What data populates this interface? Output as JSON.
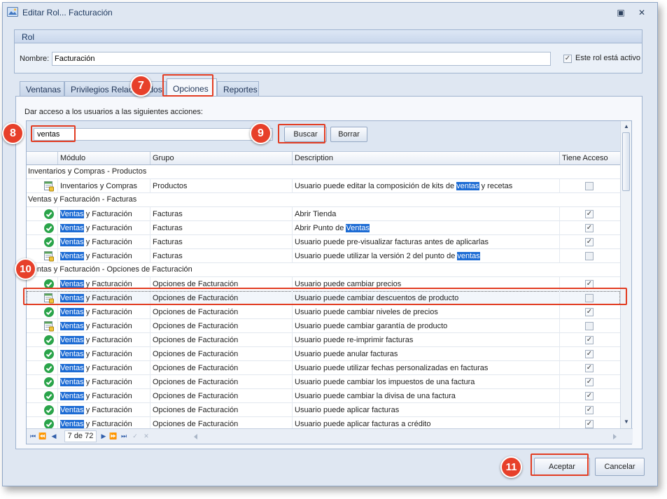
{
  "window": {
    "title": "Editar Rol... Facturación"
  },
  "rol_group": {
    "header": "Rol",
    "nombre_label": "Nombre:",
    "nombre_value": "Facturación",
    "activo_label": "Este rol está activo",
    "activo_checked": true
  },
  "tabs": [
    {
      "label": "Ventanas",
      "active": false
    },
    {
      "label": "Privilegios Relacionados",
      "active": false
    },
    {
      "label": "Opciones",
      "active": true
    },
    {
      "label": "Reportes",
      "active": false
    }
  ],
  "intro_text": "Dar acceso a los usuarios a las siguientes acciones:",
  "search": {
    "value": "ventas",
    "buscar_label": "Buscar",
    "borrar_label": "Borrar"
  },
  "columns": {
    "modulo": "Módulo",
    "grupo": "Grupo",
    "description": "Description",
    "acceso": "Tiene Acceso"
  },
  "groups": [
    "Inventarios y Compras - Productos",
    "Ventas y Facturación - Facturas",
    "Ventas y Facturación - Opciones de Facturación"
  ],
  "rows": [
    {
      "icon": "pending-icon",
      "modulo_hl": "",
      "modulo_rest": "Inventarios y Compras",
      "grupo": "Productos",
      "desc_pre": "Usuario puede editar la composición de kits de ",
      "desc_hl": "ventas",
      "desc_post": " y recetas",
      "acceso": false
    },
    {
      "icon": "granted-icon",
      "modulo_hl": "Ventas",
      "modulo_rest": " y Facturación",
      "grupo": "Facturas",
      "desc_pre": "Abrir Tienda",
      "desc_hl": "",
      "desc_post": "",
      "acceso": true
    },
    {
      "icon": "granted-icon",
      "modulo_hl": "Ventas",
      "modulo_rest": " y Facturación",
      "grupo": "Facturas",
      "desc_pre": "Abrir Punto de ",
      "desc_hl": "Ventas",
      "desc_post": "",
      "acceso": true
    },
    {
      "icon": "granted-icon",
      "modulo_hl": "Ventas",
      "modulo_rest": " y Facturación",
      "grupo": "Facturas",
      "desc_pre": "Usuario puede pre-visualizar facturas antes de aplicarlas",
      "desc_hl": "",
      "desc_post": "",
      "acceso": true
    },
    {
      "icon": "pending-icon",
      "modulo_hl": "Ventas",
      "modulo_rest": " y Facturación",
      "grupo": "Facturas",
      "desc_pre": "Usuario puede utilizar la versión 2 del punto de ",
      "desc_hl": "ventas",
      "desc_post": "",
      "acceso": false
    },
    {
      "icon": "granted-icon",
      "modulo_hl": "Ventas",
      "modulo_rest": " y Facturación",
      "grupo": "Opciones de Facturación",
      "desc_pre": "Usuario puede cambiar precios",
      "desc_hl": "",
      "desc_post": "",
      "acceso": true
    },
    {
      "icon": "pending-icon",
      "modulo_hl": "Ventas",
      "modulo_rest": " y Facturación",
      "grupo": "Opciones de Facturación",
      "desc_pre": "Usuario puede cambiar descuentos de producto",
      "desc_hl": "",
      "desc_post": "",
      "acceso": false
    },
    {
      "icon": "granted-icon",
      "modulo_hl": "Ventas",
      "modulo_rest": " y Facturación",
      "grupo": "Opciones de Facturación",
      "desc_pre": "Usuario puede cambiar niveles de precios",
      "desc_hl": "",
      "desc_post": "",
      "acceso": true
    },
    {
      "icon": "pending-icon",
      "modulo_hl": "Ventas",
      "modulo_rest": " y Facturación",
      "grupo": "Opciones de Facturación",
      "desc_pre": "Usuario puede cambiar garantía de producto",
      "desc_hl": "",
      "desc_post": "",
      "acceso": false
    },
    {
      "icon": "granted-icon",
      "modulo_hl": "Ventas",
      "modulo_rest": " y Facturación",
      "grupo": "Opciones de Facturación",
      "desc_pre": "Usuario puede re-imprimir facturas",
      "desc_hl": "",
      "desc_post": "",
      "acceso": true
    },
    {
      "icon": "granted-icon",
      "modulo_hl": "Ventas",
      "modulo_rest": " y Facturación",
      "grupo": "Opciones de Facturación",
      "desc_pre": "Usuario puede anular facturas",
      "desc_hl": "",
      "desc_post": "",
      "acceso": true
    },
    {
      "icon": "granted-icon",
      "modulo_hl": "Ventas",
      "modulo_rest": " y Facturación",
      "grupo": "Opciones de Facturación",
      "desc_pre": "Usuario puede utilizar fechas personalizadas en facturas",
      "desc_hl": "",
      "desc_post": "",
      "acceso": true
    },
    {
      "icon": "granted-icon",
      "modulo_hl": "Ventas",
      "modulo_rest": " y Facturación",
      "grupo": "Opciones de Facturación",
      "desc_pre": "Usuario puede cambiar los impuestos de una factura",
      "desc_hl": "",
      "desc_post": "",
      "acceso": true
    },
    {
      "icon": "granted-icon",
      "modulo_hl": "Ventas",
      "modulo_rest": " y Facturación",
      "grupo": "Opciones de Facturación",
      "desc_pre": "Usuario puede cambiar la divisa de una factura",
      "desc_hl": "",
      "desc_post": "",
      "acceso": true
    },
    {
      "icon": "granted-icon",
      "modulo_hl": "Ventas",
      "modulo_rest": " y Facturación",
      "grupo": "Opciones de Facturación",
      "desc_pre": "Usuario puede aplicar facturas",
      "desc_hl": "",
      "desc_post": "",
      "acceso": true
    },
    {
      "icon": "granted-icon",
      "modulo_hl": "Ventas",
      "modulo_rest": " y Facturación",
      "grupo": "Opciones de Facturación",
      "desc_pre": "Usuario puede aplicar facturas a crédito",
      "desc_hl": "",
      "desc_post": "",
      "acceso": true
    }
  ],
  "navigator": {
    "position": "7 de 72"
  },
  "footer": {
    "aceptar_label": "Aceptar",
    "cancelar_label": "Cancelar"
  },
  "callouts": {
    "c7": "7",
    "c8": "8",
    "c9": "9",
    "c10": "10",
    "c11": "11"
  },
  "colors": {
    "highlight": "#1c6bd4",
    "callout": "#e7402a",
    "granted": "#2aa44a"
  }
}
